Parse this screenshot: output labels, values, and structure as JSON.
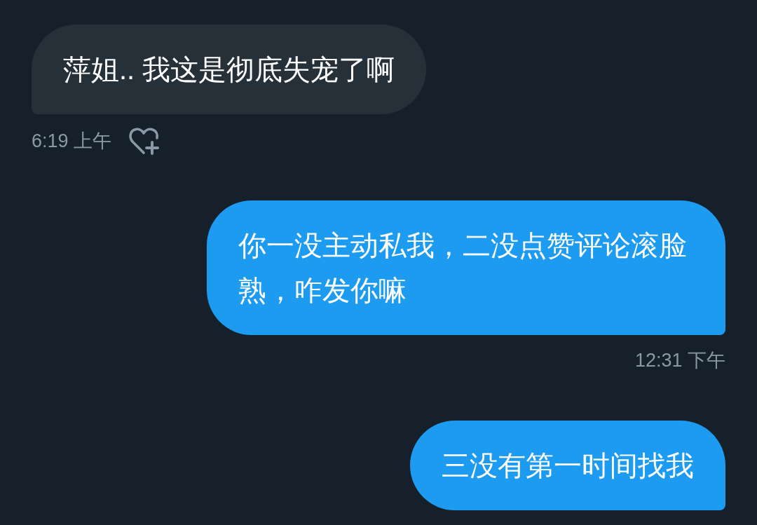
{
  "messages": [
    {
      "kind": "received",
      "text": "萍姐.. 我这是彻底失宠了啊",
      "time": "6:19 上午"
    },
    {
      "kind": "sent",
      "text": "你一没主动私我，二没点赞评论滚脸熟，咋发你嘛",
      "time": "12:31 下午"
    },
    {
      "kind": "sent",
      "text": "三没有第一时间找我"
    }
  ]
}
